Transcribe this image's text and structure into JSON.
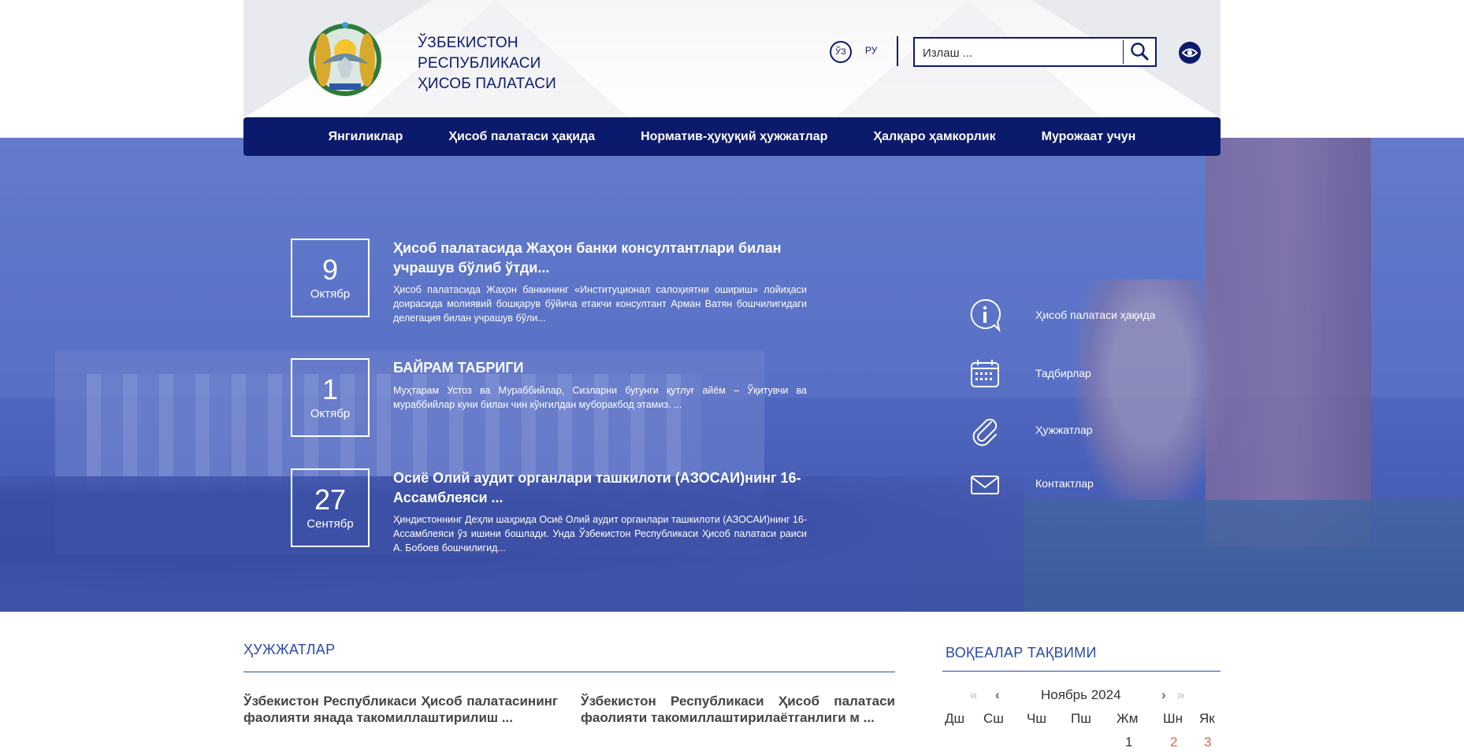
{
  "header": {
    "org_name": [
      "Ўзбекистон",
      "Республикаси",
      "Ҳисоб палатаси"
    ],
    "lang_uz": "ЎЗ",
    "lang_ru": "РУ",
    "search_placeholder": "Излаш ...",
    "emblem_icon": "state-emblem",
    "search_icon": "search-icon",
    "eye_icon": "eye-icon"
  },
  "nav": {
    "items": [
      "Янгиликлар",
      "Ҳисоб палатаси ҳақида",
      "Норматив-ҳуқуқий ҳужжатлар",
      "Ҳалқаро ҳамкорлик",
      "Мурожаат учун"
    ]
  },
  "news": [
    {
      "day": "9",
      "month": "Октябр",
      "title": "Ҳисоб палатасида Жаҳон банки консултантлари билан учрашув бўлиб ўтди...",
      "excerpt": "Ҳисоб палатасида Жаҳон банкининг «Институционал салоҳиятни ошириш» лойиҳаси доирасида молиявий бошқарув бўйича етакчи консултант Арман Ватян бошчилигидаги делегация билан учрашув бўли..."
    },
    {
      "day": "1",
      "month": "Октябр",
      "title": "БАЙРАМ ТАБРИГИ",
      "excerpt": "Муҳтарам Устоз ва Мураббийлар,   Сизларни бугунги қутлуғ айём – Ўқитувчи ва мураббийлар куни билан чин кўнгилдан муборакбод этамиз.      ..."
    },
    {
      "day": "27",
      "month": "Сентябр",
      "title": "Осиё Олий аудит органлари ташкилоти (АЗОСАИ)нинг 16-Ассамблеяси ...",
      "excerpt": "Ҳиндистоннинг Деҳли шаҳрида Осиё Олий аудит органлари ташкилоти (АЗОСАИ)нинг 16-Ассамблеяси ўз ишини бошлади. Унда Ўзбекистон Республикаси Ҳисоб палатаси раиси А. Бобоев бошчилигид..."
    }
  ],
  "quick_links": [
    {
      "label": "Ҳисоб палатаси ҳақида",
      "icon": "info-icon"
    },
    {
      "label": "Тадбирлар",
      "icon": "calendar-icon"
    },
    {
      "label": "Ҳужжатлар",
      "icon": "paperclip-icon"
    },
    {
      "label": "Контактлар",
      "icon": "envelope-icon"
    }
  ],
  "documents": {
    "heading": "ҲУЖЖАТЛАР",
    "items": [
      "Ўзбекистон Республикаси Ҳисоб палатасининг фаолияти янада такомиллаштирилиш ...",
      "Ўзбекистон Республикаси Ҳисоб палатаси фаолияти такомиллаштирилаётганлиги м ..."
    ]
  },
  "calendar": {
    "heading": "ВОҚЕАЛАР ТАҚВИМИ",
    "month": "Ноябрь 2024",
    "weekdays": [
      "Дш",
      "Сш",
      "Чш",
      "Пш",
      "Жм",
      "Шн",
      "Як"
    ],
    "first_row": [
      "1",
      "2",
      "3"
    ],
    "weekend_color": "#e0654a",
    "nav_prev_year": "«",
    "nav_prev_month": "‹",
    "nav_next_month": "›",
    "nav_next_year": "»"
  },
  "colors": {
    "brand_navy": "#0c1a6c",
    "accent_blue": "#2a4aa8"
  }
}
